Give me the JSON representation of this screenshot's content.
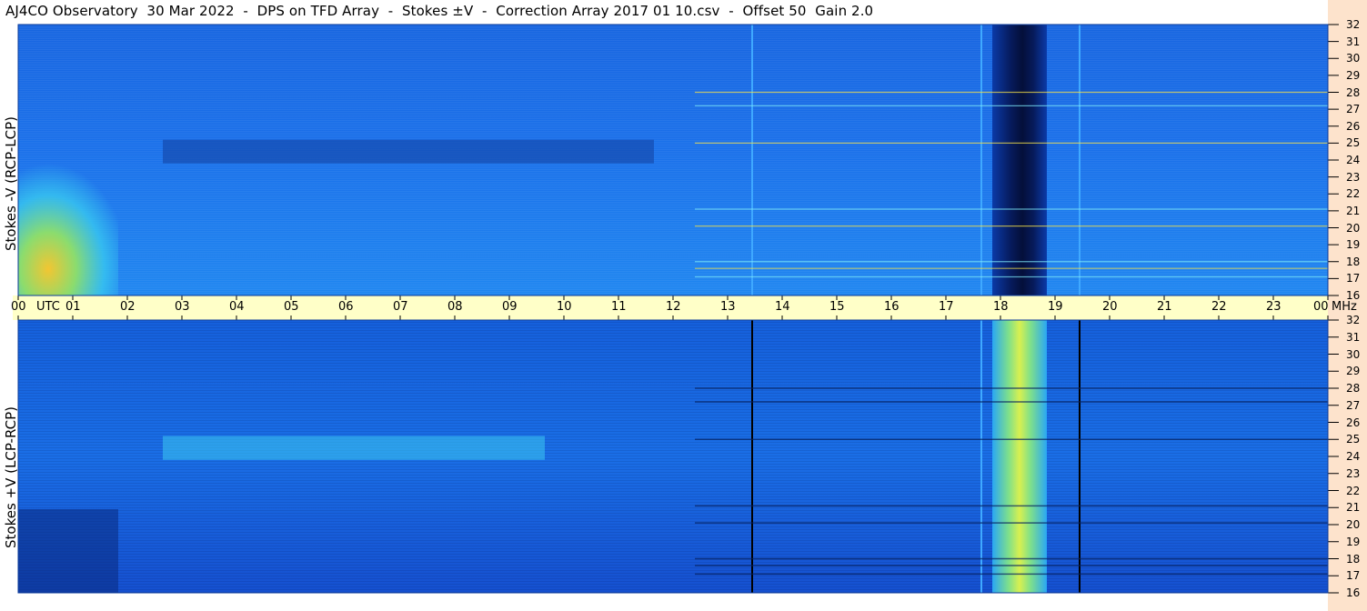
{
  "title": "AJ4CO Observatory  30 Mar 2022  -  DPS on TFD Array  -  Stokes ±V  -  Correction Array 2017 01 10.csv  -  Offset 50  Gain 2.0",
  "colors": {
    "background": "#ffffff",
    "axis_band": "#ffffc8",
    "right_strip": "#fde3cc",
    "spectrogram_base": "#1a73e8"
  },
  "chart_data": [
    {
      "type": "heatmap",
      "panel": "top",
      "ylabel": "Stokes -V (RCP-LCP)",
      "y_unit": "MHz",
      "ylim": [
        16,
        32
      ],
      "y_ticks": [
        "32",
        "31",
        "30",
        "29",
        "28",
        "27",
        "26",
        "25",
        "24",
        "23",
        "22",
        "21",
        "20",
        "19",
        "18",
        "17",
        "16"
      ],
      "x_ticks": [
        "00",
        "UTC",
        "01",
        "02",
        "03",
        "04",
        "05",
        "06",
        "07",
        "08",
        "09",
        "10",
        "11",
        "12",
        "13",
        "14",
        "15",
        "16",
        "17",
        "18",
        "19",
        "20",
        "21",
        "22",
        "23",
        "00"
      ],
      "x_unit": "MHz",
      "xlim": [
        0,
        24
      ],
      "grid": false,
      "features": [
        {
          "kind": "dark_band",
          "t_start": 17.85,
          "t_end": 18.85,
          "f_start": 16,
          "f_end": 32
        },
        {
          "kind": "vertical_line",
          "t": 13.45,
          "color": "#3fa9ff"
        },
        {
          "kind": "vertical_line",
          "t": 17.65,
          "color": "#3fa9ff"
        },
        {
          "kind": "vertical_line",
          "t": 19.45,
          "color": "#3fa9ff"
        },
        {
          "kind": "dark_rect",
          "t_start": 2.65,
          "t_end": 11.65,
          "f_start": 23.8,
          "f_end": 25.2
        }
      ]
    },
    {
      "type": "heatmap",
      "panel": "bottom",
      "ylabel": "Stokes +V (LCP-RCP)",
      "y_unit": "MHz",
      "ylim": [
        16,
        32
      ],
      "y_ticks": [
        "32",
        "31",
        "30",
        "29",
        "28",
        "27",
        "26",
        "25",
        "24",
        "23",
        "22",
        "21",
        "20",
        "19",
        "18",
        "17",
        "16"
      ],
      "x_ticks": [
        "00",
        "UTC",
        "01",
        "02",
        "03",
        "04",
        "05",
        "06",
        "07",
        "08",
        "09",
        "10",
        "11",
        "12",
        "13",
        "14",
        "15",
        "16",
        "17",
        "18",
        "19",
        "20",
        "21",
        "22",
        "23",
        "00"
      ],
      "x_unit": "MHz",
      "xlim": [
        0,
        24
      ],
      "grid": false,
      "features": [
        {
          "kind": "bright_band",
          "t_start": 17.85,
          "t_end": 18.85,
          "f_start": 16,
          "f_end": 32
        },
        {
          "kind": "vertical_line",
          "t": 13.45,
          "color": "#000000"
        },
        {
          "kind": "vertical_line",
          "t": 17.65,
          "color": "#3fa9ff"
        },
        {
          "kind": "vertical_line",
          "t": 19.45,
          "color": "#000000"
        },
        {
          "kind": "bright_rect",
          "t_start": 2.65,
          "t_end": 9.65,
          "f_start": 23.8,
          "f_end": 25.2
        }
      ]
    }
  ]
}
